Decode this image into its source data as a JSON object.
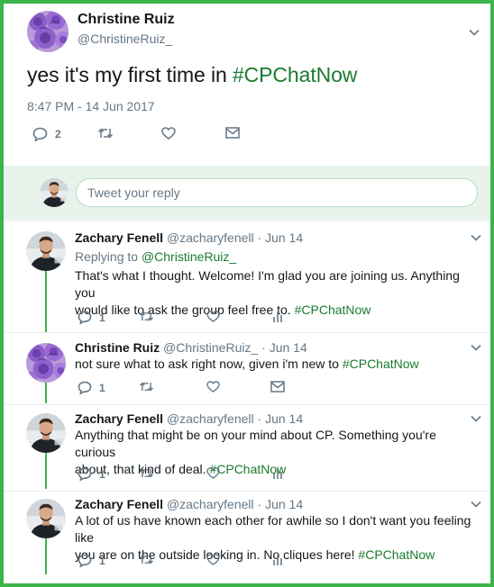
{
  "main_tweet": {
    "name": "Christine Ruiz",
    "handle": "@ChristineRuiz_",
    "text_prefix": "yes it's my first time in ",
    "text_hashtag": "#CPChatNow",
    "timestamp": "8:47 PM - 14 Jun 2017",
    "reply_count": "2"
  },
  "reply_bar": {
    "placeholder": "Tweet your reply"
  },
  "replies": [
    {
      "name": "Zachary Fenell",
      "handle": "@zacharyfenell",
      "date": "· Jun 14",
      "replying_label": "Replying to ",
      "replying_to": "@ChristineRuiz_",
      "text_line1": "That's what I thought. Welcome! I'm glad you are joining us. Anything you",
      "text_line2": "would like to ask the group feel free to. ",
      "hashtag": "#CPChatNow",
      "reply_count": "1"
    },
    {
      "name": "Christine Ruiz",
      "handle": "@ChristineRuiz_",
      "date": "· Jun 14",
      "text_line1": "not sure what to ask right now, given i'm new to ",
      "hashtag": "#CPChatNow",
      "reply_count": "1"
    },
    {
      "name": "Zachary Fenell",
      "handle": "@zacharyfenell",
      "date": "· Jun 14",
      "text_line1": "Anything that might be on your mind about CP. Something you're curious",
      "text_line2": "about, that kind of deal. ",
      "hashtag": "#CPChatNow",
      "reply_count": "1"
    },
    {
      "name": "Zachary Fenell",
      "handle": "@zacharyfenell",
      "date": "· Jun 14",
      "text_line1": "A lot of us have known each other for awhile so I don't want you feeling like",
      "text_line2": "you are on the outside looking in. No cliques here! ",
      "hashtag": "#CPChatNow",
      "reply_count": "1"
    }
  ],
  "colors": {
    "frame": "#3cb54a",
    "hashtag": "#1a7b2e",
    "reply_bar_bg": "#e6f2ea",
    "muted": "#657786",
    "text": "#14171a"
  }
}
